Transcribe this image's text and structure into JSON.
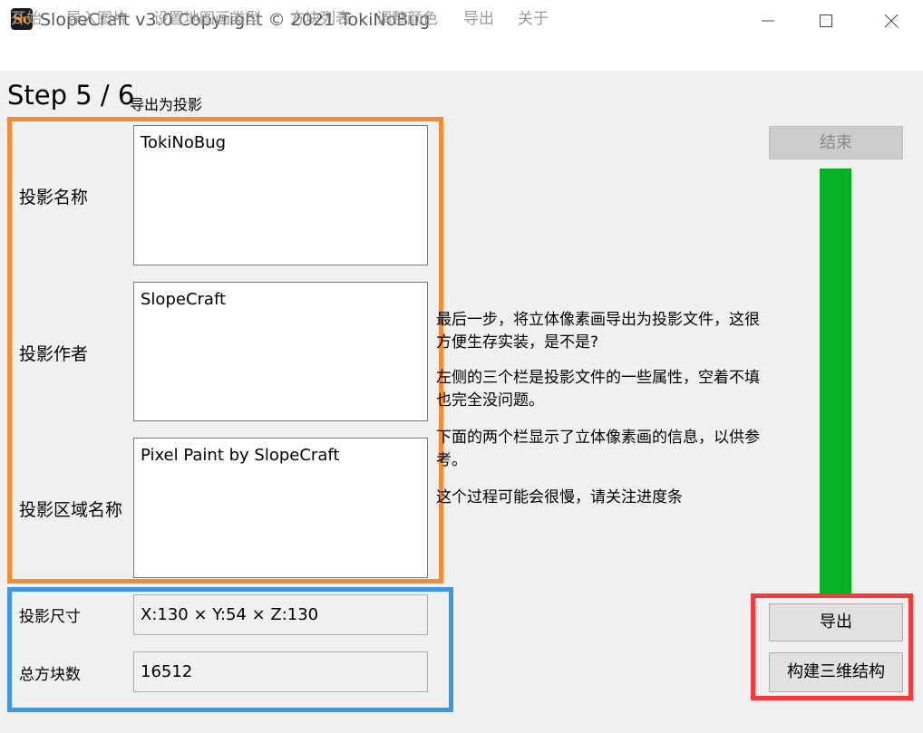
{
  "window": {
    "icon_text": "Sc",
    "title": "SlopeCraft v3.0  Copyright © 2021 TokiNoBug"
  },
  "menu": [
    "开始",
    "导入图片",
    "设置地图画类型",
    "方块列表",
    "调整颜色",
    "导出",
    "关于"
  ],
  "step": {
    "title": "Step 5 / 6",
    "subtitle": "导出为投影"
  },
  "fields": {
    "name_label": "投影名称",
    "name_value": "TokiNoBug",
    "author_label": "投影作者",
    "author_value": "SlopeCraft",
    "region_label": "投影区域名称",
    "region_value": "Pixel Paint by SlopeCraft"
  },
  "info": {
    "size_label": "投影尺寸",
    "size_value": "X:130  × Y:54  × Z:130",
    "count_label": "总方块数",
    "count_value": "16512"
  },
  "description": [
    "最后一步，将立体像素画导出为投影文件，这很方便生存实装，是不是?",
    "左侧的三个栏是投影文件的一些属性，空着不填也完全没问题。",
    "下面的两个栏显示了立体像素画的信息，以供参考。",
    "这个过程可能会很慢，请关注进度条"
  ],
  "buttons": {
    "finish": "结束",
    "export": "导出",
    "build_3d": "构建三维结构"
  },
  "progress": {
    "value": 1.0
  },
  "colors": {
    "progress_fill": "#06b025",
    "highlight_fields": "#f28c35",
    "highlight_info": "#3b96e3",
    "highlight_buttons": "#f23a3a"
  }
}
